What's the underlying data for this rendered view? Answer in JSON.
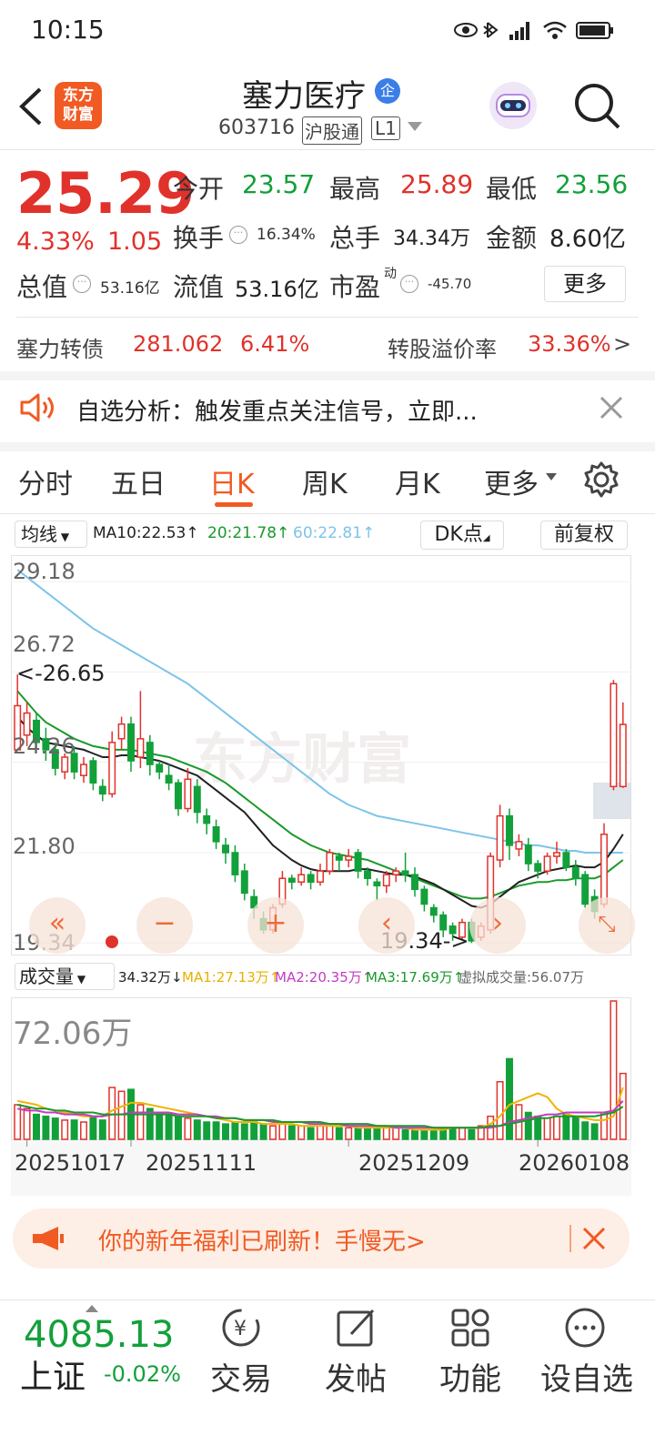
{
  "status_bar": {
    "time": "10:15"
  },
  "header": {
    "back_label": "<",
    "app_logo_text": "东方\n财富",
    "stock_name": "塞力医疗",
    "enterprise_badge": "企",
    "stock_code": "603716",
    "market_badge": "沪股通",
    "level_badge": "L1"
  },
  "quote": {
    "price": "25.29",
    "change_pct": "4.33%",
    "change_amt": "1.05",
    "open_label": "今开",
    "open_value": "23.57",
    "high_label": "最高",
    "high_value": "25.89",
    "low_label": "最低",
    "low_value": "23.56",
    "turnover_label": "换手",
    "turnover_value": "16.34%",
    "volume_label": "总手",
    "volume_value": "34.34万",
    "amount_label": "金额",
    "amount_value": "8.60亿",
    "mktcap_label": "总值",
    "mktcap_value": "53.16亿",
    "float_label": "流值",
    "float_value": "53.16亿",
    "pe_label": "市盈",
    "pe_super": "动",
    "pe_value": "-45.70",
    "more_button": "更多"
  },
  "bond": {
    "name": "塞力转债",
    "price": "281.062",
    "change": "6.41%",
    "premium_label": "转股溢价率",
    "premium_value": "33.36%",
    "arrow": ">"
  },
  "notice": {
    "text": "自选分析：触发重点关注信号，立即..."
  },
  "tabs": [
    "分时",
    "五日",
    "日K",
    "周K",
    "月K",
    "更多"
  ],
  "active_tab": "日K",
  "ma_bar": {
    "selector": "均线",
    "ma10": "MA10:22.53↑",
    "ma20": "20:21.78↑",
    "ma60": "60:22.81↑",
    "dk_button": "DK点",
    "adjust_button": "前复权"
  },
  "kline": {
    "y_ticks": [
      "29.18",
      "26.72",
      "24.26",
      "21.80",
      "19.34"
    ],
    "high_marker": "<-26.65",
    "low_marker": "19.34->",
    "candles": [
      [
        24.6,
        25.8,
        24.8,
        26.65
      ],
      [
        25.0,
        25.6,
        24.7,
        25.9
      ],
      [
        25.4,
        24.8,
        24.6,
        25.6
      ],
      [
        24.9,
        24.6,
        24.3,
        25.2
      ],
      [
        24.6,
        24.1,
        23.9,
        24.8
      ],
      [
        24.0,
        24.4,
        23.8,
        24.5
      ],
      [
        24.5,
        24.0,
        23.8,
        24.7
      ],
      [
        23.9,
        24.2,
        23.7,
        24.4
      ],
      [
        24.3,
        23.7,
        23.5,
        24.4
      ],
      [
        23.6,
        23.4,
        23.2,
        23.8
      ],
      [
        23.4,
        24.8,
        23.3,
        25.1
      ],
      [
        24.9,
        25.3,
        24.6,
        25.5
      ],
      [
        25.3,
        24.3,
        24.0,
        25.5
      ],
      [
        24.4,
        24.9,
        24.1,
        26.2
      ],
      [
        24.8,
        24.2,
        23.9,
        25.0
      ],
      [
        24.2,
        24.0,
        23.8,
        24.3
      ],
      [
        23.9,
        23.7,
        23.5,
        24.2
      ],
      [
        23.7,
        23.0,
        22.8,
        23.8
      ],
      [
        23.0,
        23.8,
        22.9,
        24.1
      ],
      [
        23.6,
        22.9,
        22.6,
        23.8
      ],
      [
        22.8,
        22.6,
        22.3,
        23.0
      ],
      [
        22.5,
        22.1,
        21.9,
        22.7
      ],
      [
        22.0,
        21.8,
        21.5,
        22.2
      ],
      [
        21.8,
        21.2,
        21.0,
        22.0
      ],
      [
        21.3,
        20.7,
        20.5,
        21.5
      ],
      [
        20.6,
        20.3,
        20.0,
        20.8
      ],
      [
        20.0,
        19.7,
        19.6,
        20.2
      ],
      [
        19.7,
        20.3,
        19.6,
        20.4
      ],
      [
        20.4,
        21.1,
        20.3,
        21.3
      ],
      [
        21.1,
        21.0,
        20.8,
        21.2
      ],
      [
        21.0,
        21.2,
        20.9,
        21.4
      ],
      [
        21.2,
        21.0,
        20.8,
        21.3
      ],
      [
        21.0,
        21.3,
        20.9,
        21.5
      ],
      [
        21.3,
        21.8,
        21.2,
        21.9
      ],
      [
        21.7,
        21.6,
        21.3,
        21.8
      ],
      [
        21.6,
        21.7,
        21.4,
        21.9
      ],
      [
        21.8,
        21.3,
        21.1,
        21.9
      ],
      [
        21.3,
        21.1,
        20.9,
        21.4
      ],
      [
        21.0,
        20.9,
        20.5,
        21.1
      ],
      [
        20.9,
        21.2,
        20.7,
        21.3
      ],
      [
        21.2,
        21.3,
        21.0,
        21.4
      ],
      [
        21.3,
        21.2,
        21.0,
        21.8
      ],
      [
        21.2,
        20.8,
        20.6,
        21.4
      ],
      [
        20.8,
        20.4,
        20.2,
        20.9
      ],
      [
        20.3,
        20.1,
        19.9,
        20.4
      ],
      [
        20.1,
        19.7,
        19.5,
        20.2
      ],
      [
        19.8,
        19.6,
        19.4,
        19.9
      ],
      [
        19.5,
        19.9,
        19.4,
        20.0
      ],
      [
        19.9,
        19.4,
        19.34,
        20.0
      ],
      [
        19.5,
        19.8,
        19.4,
        19.9
      ],
      [
        19.7,
        21.7,
        19.6,
        21.8
      ],
      [
        21.6,
        22.8,
        21.4,
        23.1
      ],
      [
        22.8,
        22.0,
        21.6,
        23.0
      ],
      [
        21.9,
        22.1,
        21.7,
        22.3
      ],
      [
        22.0,
        21.5,
        21.3,
        22.2
      ],
      [
        21.5,
        21.3,
        21.1,
        21.6
      ],
      [
        21.3,
        21.7,
        21.2,
        21.8
      ],
      [
        21.7,
        21.8,
        21.5,
        22.1
      ],
      [
        21.8,
        21.4,
        21.3,
        21.9
      ],
      [
        21.4,
        21.1,
        20.9,
        21.6
      ],
      [
        21.2,
        20.4,
        20.3,
        21.3
      ],
      [
        20.6,
        20.2,
        20.0,
        20.8
      ],
      [
        20.4,
        22.3,
        20.3,
        22.6
      ],
      [
        23.6,
        26.4,
        23.5,
        26.5
      ],
      [
        23.6,
        25.29,
        23.56,
        25.89
      ]
    ],
    "ma_series": {
      "ma10": [
        25.5,
        25.2,
        25.0,
        24.8,
        24.75,
        24.7,
        24.65,
        24.6,
        24.5,
        24.4,
        24.4,
        24.45,
        24.45,
        24.4,
        24.35,
        24.3,
        24.2,
        24.1,
        24.0,
        23.9,
        23.7,
        23.5,
        23.3,
        23.1,
        22.9,
        22.6,
        22.3,
        22.0,
        21.8,
        21.6,
        21.45,
        21.35,
        21.3,
        21.3,
        21.3,
        21.3,
        21.35,
        21.35,
        21.3,
        21.25,
        21.2,
        21.2,
        21.15,
        21.05,
        20.95,
        20.8,
        20.65,
        20.5,
        20.35,
        20.3,
        20.4,
        20.6,
        20.8,
        21.0,
        21.1,
        21.2,
        21.3,
        21.35,
        21.4,
        21.45,
        21.4,
        21.4,
        21.55,
        21.9,
        22.3
      ],
      "ma20": [
        26.2,
        25.9,
        25.6,
        25.35,
        25.2,
        25.05,
        24.9,
        24.8,
        24.7,
        24.65,
        24.6,
        24.6,
        24.6,
        24.55,
        24.5,
        24.45,
        24.4,
        24.3,
        24.2,
        24.1,
        24.0,
        23.85,
        23.7,
        23.5,
        23.3,
        23.1,
        22.9,
        22.7,
        22.5,
        22.3,
        22.15,
        22.0,
        21.9,
        21.8,
        21.75,
        21.7,
        21.65,
        21.6,
        21.5,
        21.4,
        21.3,
        21.2,
        21.1,
        21.0,
        20.9,
        20.8,
        20.7,
        20.6,
        20.55,
        20.55,
        20.6,
        20.7,
        20.8,
        20.9,
        20.95,
        21.0,
        21.0,
        21.05,
        21.05,
        21.1,
        21.1,
        21.1,
        21.2,
        21.4,
        21.6
      ],
      "ma60": [
        29.5,
        29.3,
        29.1,
        28.9,
        28.7,
        28.5,
        28.3,
        28.1,
        27.9,
        27.75,
        27.6,
        27.45,
        27.3,
        27.15,
        27.0,
        26.85,
        26.7,
        26.55,
        26.4,
        26.2,
        26.0,
        25.8,
        25.6,
        25.4,
        25.2,
        25.0,
        24.8,
        24.6,
        24.4,
        24.2,
        24.0,
        23.8,
        23.6,
        23.4,
        23.25,
        23.1,
        23.0,
        22.9,
        22.8,
        22.75,
        22.7,
        22.65,
        22.6,
        22.55,
        22.5,
        22.45,
        22.4,
        22.35,
        22.3,
        22.25,
        22.2,
        22.15,
        22.1,
        22.05,
        22.0,
        22.0,
        21.95,
        21.9,
        21.85,
        21.85,
        21.8,
        21.8,
        21.8,
        21.8,
        21.8
      ]
    }
  },
  "volume_bar": {
    "selector": "成交量",
    "current": "34.32万↓",
    "ma1": "MA1:27.13万↑",
    "ma2": "MA2:20.35万↑",
    "ma3": "MA3:17.69万↑",
    "virtual": "虚拟成交量:56.07万",
    "max_label": "72.06万"
  },
  "volume": {
    "max": 72.06,
    "values": [
      18,
      16,
      13,
      12,
      11,
      10,
      10,
      9,
      12,
      10,
      27,
      25,
      26,
      18,
      16,
      14,
      13,
      12,
      11,
      10,
      9,
      9,
      8,
      9,
      8,
      9,
      8,
      7,
      8,
      7,
      7,
      6,
      7,
      7,
      6,
      6,
      6,
      6,
      6,
      6,
      6,
      5,
      5,
      5,
      5,
      6,
      6,
      6,
      5,
      7,
      12,
      30,
      42,
      18,
      14,
      12,
      11,
      12,
      13,
      12,
      9,
      8,
      14,
      72.06,
      34.32
    ],
    "ma1": [
      20,
      19,
      18,
      16,
      15,
      14,
      13,
      12,
      12,
      12,
      15,
      17,
      19,
      19,
      18,
      17,
      16,
      15,
      14,
      13,
      12,
      11,
      10,
      9,
      9,
      9,
      8,
      8,
      8,
      8,
      7,
      7,
      7,
      7,
      7,
      7,
      6,
      6,
      6,
      6,
      6,
      6,
      5,
      5,
      5,
      5,
      6,
      6,
      6,
      6,
      8,
      12,
      18,
      20,
      22,
      24,
      22,
      16,
      13,
      12,
      11,
      10,
      10,
      12,
      27
    ],
    "ma2": [
      16,
      15,
      15,
      14,
      14,
      13,
      13,
      13,
      12,
      12,
      13,
      13,
      14,
      14,
      14,
      14,
      14,
      13,
      13,
      13,
      12,
      12,
      11,
      11,
      10,
      10,
      10,
      9,
      9,
      9,
      9,
      8,
      8,
      8,
      8,
      7,
      7,
      7,
      7,
      7,
      6,
      6,
      6,
      6,
      6,
      6,
      6,
      6,
      6,
      6,
      6,
      7,
      9,
      10,
      11,
      12,
      13,
      13,
      14,
      14,
      14,
      14,
      14,
      15,
      20
    ],
    "ma3": [
      18,
      17,
      16,
      16,
      15,
      15,
      14,
      14,
      14,
      13,
      13,
      13,
      13,
      13,
      13,
      13,
      13,
      12,
      12,
      12,
      12,
      11,
      11,
      11,
      10,
      10,
      10,
      10,
      9,
      9,
      9,
      9,
      9,
      8,
      8,
      8,
      8,
      8,
      7,
      7,
      7,
      7,
      7,
      7,
      6,
      6,
      6,
      6,
      6,
      6,
      7,
      7,
      8,
      9,
      10,
      11,
      11,
      12,
      12,
      12,
      12,
      12,
      13,
      14,
      17
    ]
  },
  "dates": [
    "20251017",
    "20251111",
    "20251209",
    "20260108"
  ],
  "promo": {
    "text": "你的新年福利已刷新！手慢无>"
  },
  "bottom_nav": {
    "index_value": "4085.13",
    "index_name": "上证",
    "index_change": "-0.02%",
    "items": [
      "交易",
      "发帖",
      "功能",
      "设自选"
    ]
  },
  "colors": {
    "rise": "#e0322b",
    "fall": "#12a03a",
    "accent": "#f15a22",
    "ma10": "#222222",
    "ma20": "#1a9a2a",
    "ma60": "#7cc4ea",
    "vol_ma1": "#f0b400",
    "vol_ma2": "#c43ac4",
    "vol_ma3": "#1a9a2a"
  }
}
